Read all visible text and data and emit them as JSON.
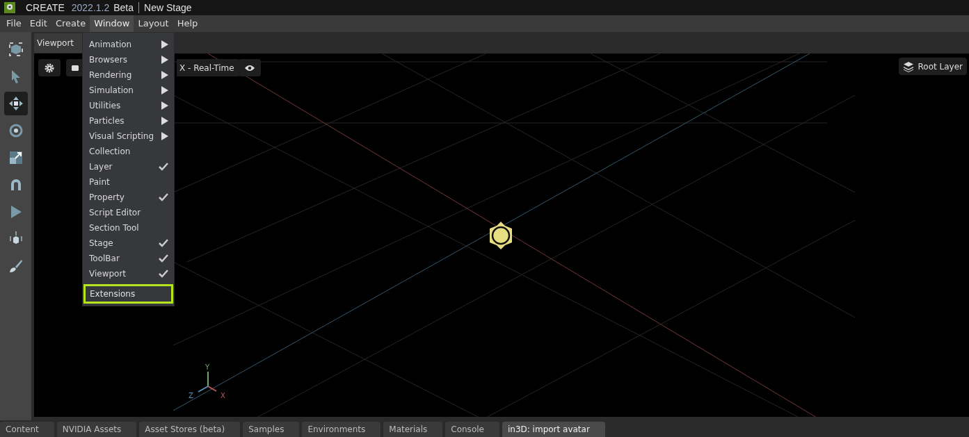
{
  "title_bar": {
    "app": "CREATE",
    "version": "2022.1.2",
    "edition": "Beta",
    "document": "New Stage"
  },
  "menu_bar": [
    {
      "label": "File",
      "selected": false
    },
    {
      "label": "Edit",
      "selected": false
    },
    {
      "label": "Create",
      "selected": false
    },
    {
      "label": "Window",
      "selected": true
    },
    {
      "label": "Layout",
      "selected": false
    },
    {
      "label": "Help",
      "selected": false
    }
  ],
  "window_menu": [
    {
      "label": "Animation",
      "kind": "submenu",
      "highlighted": false
    },
    {
      "label": "Browsers",
      "kind": "submenu",
      "highlighted": false
    },
    {
      "label": "Rendering",
      "kind": "submenu",
      "highlighted": false
    },
    {
      "label": "Simulation",
      "kind": "submenu",
      "highlighted": false
    },
    {
      "label": "Utilities",
      "kind": "submenu",
      "highlighted": false
    },
    {
      "label": "Particles",
      "kind": "submenu",
      "highlighted": false
    },
    {
      "label": "Visual Scripting",
      "kind": "submenu",
      "highlighted": false
    },
    {
      "label": "Collection",
      "kind": "toggle",
      "checked": false,
      "highlighted": false
    },
    {
      "label": "Layer",
      "kind": "toggle",
      "checked": true,
      "highlighted": false
    },
    {
      "label": "Paint",
      "kind": "toggle",
      "checked": false,
      "highlighted": false
    },
    {
      "label": "Property",
      "kind": "toggle",
      "checked": true,
      "highlighted": false
    },
    {
      "label": "Script Editor",
      "kind": "toggle",
      "checked": false,
      "highlighted": false
    },
    {
      "label": "Section Tool",
      "kind": "toggle",
      "checked": false,
      "highlighted": false
    },
    {
      "label": "Stage",
      "kind": "toggle",
      "checked": true,
      "highlighted": false
    },
    {
      "label": "ToolBar",
      "kind": "toggle",
      "checked": true,
      "highlighted": false
    },
    {
      "label": "Viewport",
      "kind": "toggle",
      "checked": true,
      "highlighted": false
    },
    {
      "label": "Extensions",
      "kind": "toggle",
      "checked": false,
      "highlighted": true
    }
  ],
  "toolbar": [
    {
      "kind": "frame",
      "selected": false
    },
    {
      "kind": "select",
      "selected": false
    },
    {
      "kind": "move",
      "selected": true
    },
    {
      "kind": "rotate",
      "selected": false
    },
    {
      "kind": "scale",
      "selected": false
    },
    {
      "kind": "snap",
      "selected": false
    },
    {
      "kind": "play",
      "selected": false
    },
    {
      "kind": "drop",
      "selected": false
    },
    {
      "kind": "paint",
      "selected": false
    }
  ],
  "viewport": {
    "tab": "Viewport",
    "render_mode": "X - Real-Time",
    "layer": "Root Layer",
    "axes": {
      "y": "Y",
      "z": "Z",
      "x": "X"
    }
  },
  "bottom_tabs": [
    {
      "label": "Content",
      "selected": false
    },
    {
      "label": "NVIDIA Assets",
      "selected": false
    },
    {
      "label": "Asset Stores (beta)",
      "selected": false
    },
    {
      "label": "Samples",
      "selected": false
    },
    {
      "label": "Environments",
      "selected": false
    },
    {
      "label": "Materials",
      "selected": false
    },
    {
      "label": "Console",
      "selected": false
    },
    {
      "label": "in3D: import avatar",
      "selected": true
    }
  ]
}
